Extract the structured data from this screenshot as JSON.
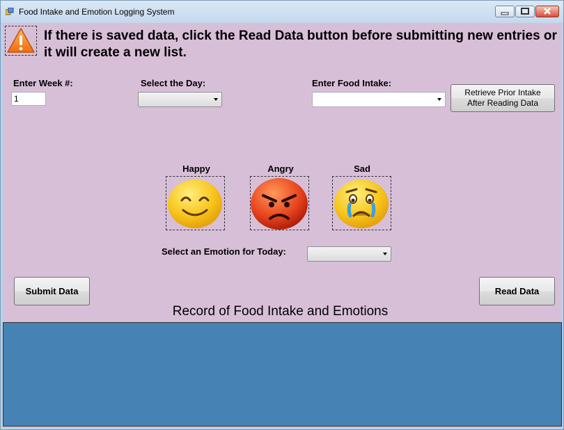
{
  "window": {
    "title": "Food Intake and Emotion Logging System"
  },
  "warning": {
    "icon": "warning-icon",
    "text": "If there is saved data, click the Read Data button before submitting new entries or it will create a new list."
  },
  "week": {
    "label": "Enter Week #:",
    "value": "1"
  },
  "day": {
    "label": "Select the Day:",
    "selected": ""
  },
  "food": {
    "label": "Enter Food Intake:",
    "selected": ""
  },
  "retrieve_button": {
    "label_line1": "Retrieve Prior Intake",
    "label_line2": "After Reading Data"
  },
  "emotions": [
    {
      "label": "Happy",
      "icon": "happy-face-icon",
      "color": "#f5c518"
    },
    {
      "label": "Angry",
      "icon": "angry-face-icon",
      "color": "#e8451e"
    },
    {
      "label": "Sad",
      "icon": "crying-face-icon",
      "color": "#f5c518"
    }
  ],
  "emotion_select": {
    "label": "Select an Emotion for Today:",
    "selected": ""
  },
  "submit_button": {
    "label": "Submit Data"
  },
  "read_button": {
    "label": "Read Data"
  },
  "record": {
    "title": "Record of Food Intake and Emotions",
    "background": "#4682b4"
  },
  "colors": {
    "form_background": "#d8bfd8"
  }
}
